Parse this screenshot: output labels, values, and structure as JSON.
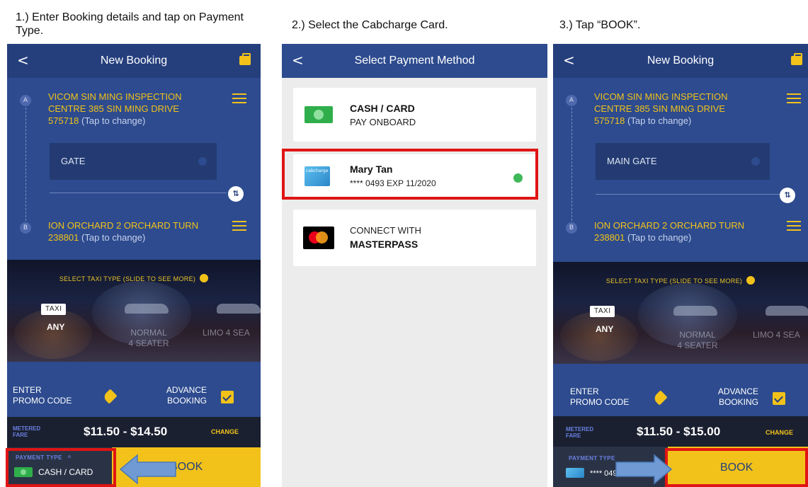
{
  "captions": {
    "step1": "1.) Enter Booking details and tap on Payment Type.",
    "step2": "2.) Select the Cabcharge Card.",
    "step3": "3.) Tap “BOOK”."
  },
  "colors": {
    "navy": "#2d4b8e",
    "navy_dark": "#253f7d",
    "accent_yellow": "#f2c21a",
    "highlight_red": "#e01414",
    "arrow_blue": "#6f9ad4"
  },
  "icons": [
    "back-chevron-icon",
    "wallet-icon",
    "list-icon",
    "swap-icon",
    "info-icon",
    "tag-icon",
    "calendar-check-icon",
    "cash-icon",
    "cabcharge-card-icon",
    "mastercard-icon",
    "check-circle-icon",
    "arrow-left-icon",
    "arrow-right-icon"
  ],
  "screen1": {
    "header": {
      "back": "<",
      "title": "New Booking"
    },
    "pickup": {
      "marker": "A",
      "address": "VICOM SIN MING INSPECTION CENTRE 385 SIN MING DRIVE",
      "postcode": "575718",
      "hint": "(Tap to change)"
    },
    "gate": "GATE",
    "swap": "⇅",
    "dropoff": {
      "marker": "B",
      "address": "ION ORCHARD 2 ORCHARD TURN",
      "postcode": "238801",
      "hint": "(Tap to change)"
    },
    "taxi": {
      "select_label": "SELECT TAXI TYPE (SLIDE TO SEE MORE)",
      "badge": "TAXI",
      "types": [
        {
          "line1": "ANY",
          "line2": ""
        },
        {
          "line1": "NORMAL",
          "line2": "4 SEATER"
        },
        {
          "line1": "LIMO 4 SEA",
          "line2": ""
        }
      ]
    },
    "promo": {
      "line1": "ENTER",
      "line2": "PROMO CODE"
    },
    "advance": {
      "line1": "ADVANCE",
      "line2": "BOOKING"
    },
    "fare": {
      "metered_1": "METERED",
      "metered_2": "FARE",
      "range": "$11.50 - $14.50",
      "change": "CHANGE"
    },
    "payment": {
      "label": "PAYMENT TYPE",
      "caret": "^",
      "value": "CASH / CARD"
    },
    "book": "BOOK"
  },
  "screen2": {
    "header": {
      "back": "<",
      "title": "Select Payment Method"
    },
    "methods": [
      {
        "title": "CASH / CARD",
        "subtitle": "PAY ONBOARD"
      },
      {
        "title": "Mary Tan",
        "subtitle": "**** 0493  EXP 11/2020",
        "card_text": "cabcharge",
        "selected": true
      },
      {
        "title": "CONNECT WITH",
        "subtitle": "MASTERPASS"
      }
    ]
  },
  "screen3": {
    "header": {
      "back": "<",
      "title": "New Booking"
    },
    "pickup": {
      "marker": "A",
      "address": "VICOM SIN MING INSPECTION CENTRE 385 SIN MING DRIVE",
      "postcode": "575718",
      "hint": "(Tap to change)"
    },
    "gate": "MAIN GATE",
    "swap": "⇅",
    "dropoff": {
      "marker": "B",
      "address": "ION ORCHARD 2 ORCHARD TURN",
      "postcode": "238801",
      "hint": "(Tap to change)"
    },
    "taxi": {
      "select_label": "SELECT TAXI TYPE (SLIDE TO SEE MORE)",
      "badge": "TAXI",
      "types": [
        {
          "line1": "ANY",
          "line2": ""
        },
        {
          "line1": "NORMAL",
          "line2": "4 SEATER"
        },
        {
          "line1": "LIMO 4 SEA",
          "line2": ""
        }
      ]
    },
    "promo": {
      "line1": "ENTER",
      "line2": "PROMO CODE"
    },
    "advance": {
      "line1": "ADVANCE",
      "line2": "BOOKING"
    },
    "fare": {
      "metered_1": "METERED",
      "metered_2": "FARE",
      "range": "$11.50 - $15.00",
      "change": "CHANGE"
    },
    "payment": {
      "label": "PAYMENT TYPE",
      "value": "**** 0493"
    },
    "book": "BOOK"
  }
}
